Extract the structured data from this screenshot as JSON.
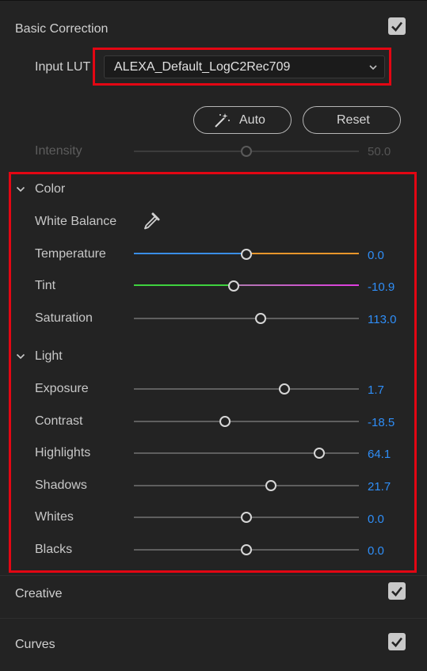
{
  "panel": {
    "section_basic": "Basic Correction",
    "section_creative": "Creative",
    "section_curves": "Curves"
  },
  "lut": {
    "label": "Input LUT",
    "value": "ALEXA_Default_LogC2Rec709"
  },
  "buttons": {
    "auto": "Auto",
    "reset": "Reset"
  },
  "intensity": {
    "label": "Intensity",
    "value": "50.0",
    "level": 0.5
  },
  "color": {
    "title": "Color",
    "white_balance": "White Balance",
    "sliders": [
      {
        "label": "Temperature",
        "value": "0.0",
        "level": 0.5
      },
      {
        "label": "Tint",
        "value": "-10.9",
        "level": 0.445
      },
      {
        "label": "Saturation",
        "value": "113.0",
        "level": 0.565
      }
    ]
  },
  "light": {
    "title": "Light",
    "sliders": [
      {
        "label": "Exposure",
        "value": "1.7",
        "level": 0.67
      },
      {
        "label": "Contrast",
        "value": "-18.5",
        "level": 0.405
      },
      {
        "label": "Highlights",
        "value": "64.1",
        "level": 0.825
      },
      {
        "label": "Shadows",
        "value": "21.7",
        "level": 0.61
      },
      {
        "label": "Whites",
        "value": "0.0",
        "level": 0.5
      },
      {
        "label": "Blacks",
        "value": "0.0",
        "level": 0.5
      }
    ]
  },
  "colors": {
    "accent_value": "#2f8ef7",
    "highlight_box": "#e30613",
    "temperature_cold": "#3a8ee6",
    "temperature_warm": "#e8962b",
    "tint_green": "#3fd23f",
    "tint_magenta": "#e03ce0"
  },
  "icons": {
    "section_toggle": "checkmark-icon",
    "dropdown": "chevron-down-icon",
    "auto": "magic-wand-icon",
    "white_balance": "eyedropper-icon",
    "group_toggle": "chevron-down-icon"
  }
}
